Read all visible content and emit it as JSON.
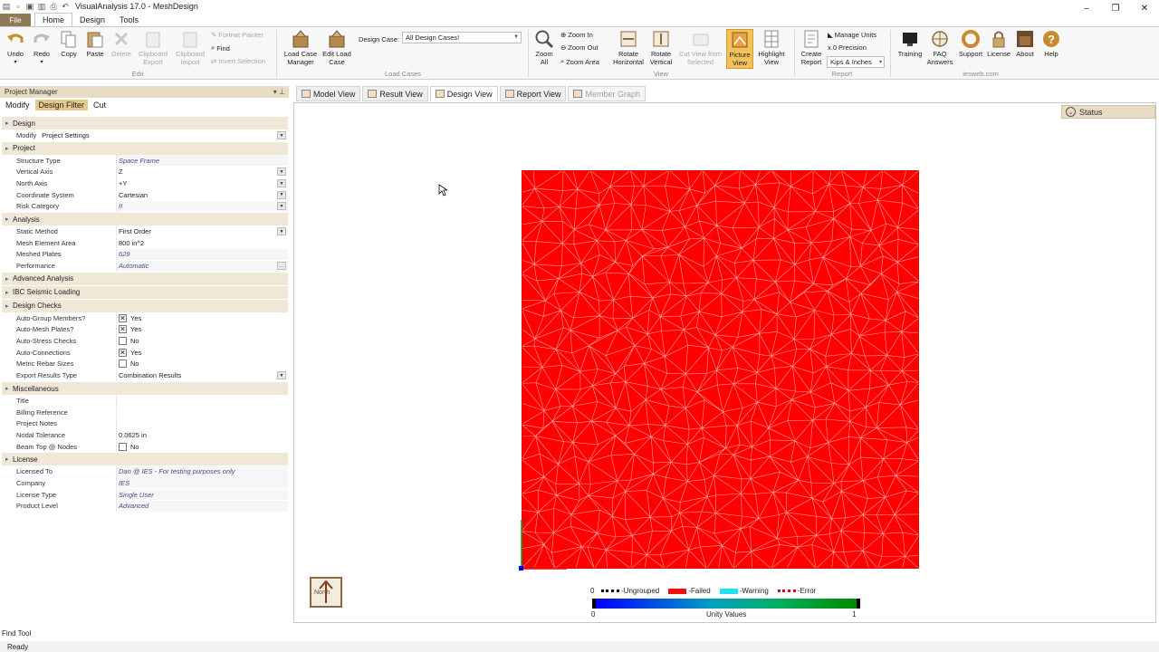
{
  "window": {
    "title": "VisualAnalysis 17.0 - MeshDesign"
  },
  "ribbon_tabs": {
    "file": "File",
    "tabs": [
      "Home",
      "Design",
      "Tools"
    ],
    "active": "Home"
  },
  "ribbon": {
    "undo": "Undo",
    "redo": "Redo",
    "copy": "Copy",
    "paste": "Paste",
    "delete": "Delete",
    "clipboard_export": "Clipboard\nExport",
    "clipboard_import": "Clipboard\nImport",
    "format_painter": "Format Painter",
    "find": "Find",
    "invert_selection": "Invert Selection",
    "edit_group": "Edit",
    "load_case_manager": "Load Case\nManager",
    "edit_load_case": "Edit Load\nCase",
    "design_case_label": "Design Case:",
    "design_case_value": "All Design Cases!",
    "load_cases_group": "Load Cases",
    "zoom_all": "Zoom\nAll",
    "zoom_in": "Zoom In",
    "zoom_out": "Zoom Out",
    "zoom_area": "Zoom Area",
    "rotate_horizontal": "Rotate\nHorizontal",
    "rotate_vertical": "Rotate\nVertical",
    "cut_view": "Cut View from\nSelected",
    "picture_view": "Picture\nView",
    "highlight_view": "Highlight\nView",
    "view_group": "View",
    "create_report": "Create\nReport",
    "manage_units": "Manage Units",
    "precision": "Precision",
    "units_value": "Kips & Inches",
    "report_group": "Report",
    "training": "Training",
    "faq_answers": "FAQ\nAnswers",
    "support": "Support",
    "license": "License",
    "about": "About",
    "help": "Help",
    "iesweb_group": "iesweb.com"
  },
  "project_manager": {
    "header": "Project Manager",
    "tabs": [
      "Modify",
      "Design Filter",
      "Cut"
    ],
    "active_tab": "Design Filter",
    "sections": [
      {
        "title": "Design",
        "rows": [
          {
            "label": "Modify",
            "value": "Project Settings",
            "dropdown": true,
            "inline": true
          }
        ]
      },
      {
        "title": "Project",
        "rows": [
          {
            "label": "Structure Type",
            "value": "Space Frame",
            "italic": true
          },
          {
            "label": "Vertical Axis",
            "value": "Z",
            "dropdown": true
          },
          {
            "label": "North Axis",
            "value": "+Y",
            "dropdown": true
          },
          {
            "label": "Coordinate System",
            "value": "Cartesian",
            "dropdown": true
          },
          {
            "label": "Risk Category",
            "value": "II",
            "dropdown": true,
            "italic": true
          }
        ]
      },
      {
        "title": "Analysis",
        "rows": [
          {
            "label": "Static Method",
            "value": "First Order",
            "dropdown": true
          },
          {
            "label": "Mesh Element Area",
            "value": "800 in^2"
          },
          {
            "label": "Meshed Plates",
            "value": "629",
            "italic": true
          },
          {
            "label": "Performance",
            "value": "Automatic",
            "italic": true,
            "ellipsis": true
          }
        ]
      },
      {
        "title": "Advanced Analysis",
        "rows": []
      },
      {
        "title": "IBC Seismic Loading",
        "rows": []
      },
      {
        "title": "Design Checks",
        "rows": [
          {
            "label": "Auto-Group Members?",
            "value": "Yes",
            "check": true
          },
          {
            "label": "Auto-Mesh Plates?",
            "value": "Yes",
            "check": true
          },
          {
            "label": "Auto-Stress Checks",
            "value": "No",
            "check": false
          },
          {
            "label": "Auto-Connections",
            "value": "Yes",
            "check": true
          },
          {
            "label": "Metric Rebar Sizes",
            "value": "No",
            "check": false
          },
          {
            "label": "Export Results Type",
            "value": "Combination Results",
            "dropdown": true
          }
        ]
      },
      {
        "title": "Miscellaneous",
        "rows": [
          {
            "label": "Title",
            "value": ""
          },
          {
            "label": "Billing Reference",
            "value": ""
          },
          {
            "label": "Project Notes",
            "value": ""
          },
          {
            "label": "Nodal Tolerance",
            "value": "0.0625 in"
          },
          {
            "label": "Beam Top @ Nodes",
            "value": "No",
            "check": false
          }
        ]
      },
      {
        "title": "License",
        "rows": [
          {
            "label": "Licensed To",
            "value": "Dan @ IES - For testing purposes only",
            "italic": true
          },
          {
            "label": "Company",
            "value": "IES",
            "italic": true
          },
          {
            "label": "License Type",
            "value": "Single User",
            "italic": true
          },
          {
            "label": "Product Level",
            "value": "Advanced",
            "italic": true
          }
        ]
      }
    ]
  },
  "doc_tabs": [
    {
      "label": "Model View",
      "active": false,
      "disabled": false
    },
    {
      "label": "Result View",
      "active": false,
      "disabled": false
    },
    {
      "label": "Design View",
      "active": true,
      "disabled": false
    },
    {
      "label": "Report View",
      "active": false,
      "disabled": false
    },
    {
      "label": "Member Graph",
      "active": false,
      "disabled": true
    }
  ],
  "viewport": {
    "status_button": "Status",
    "north_label": "North",
    "mesh_color": "#ff0000"
  },
  "legend": {
    "items": [
      {
        "label": "-Ungrouped",
        "color": "#000000",
        "style": "dotted"
      },
      {
        "label": "-Failed",
        "color": "#ee1111",
        "style": "solid"
      },
      {
        "label": "-Warning",
        "color": "#22e0f0",
        "style": "solid"
      },
      {
        "label": "-Error",
        "color": "#cc1111",
        "style": "dotted"
      }
    ],
    "min": "0",
    "max": "1",
    "caption": "Unity Values"
  },
  "footer": {
    "find_tool": "Find Tool",
    "status": "Ready"
  }
}
